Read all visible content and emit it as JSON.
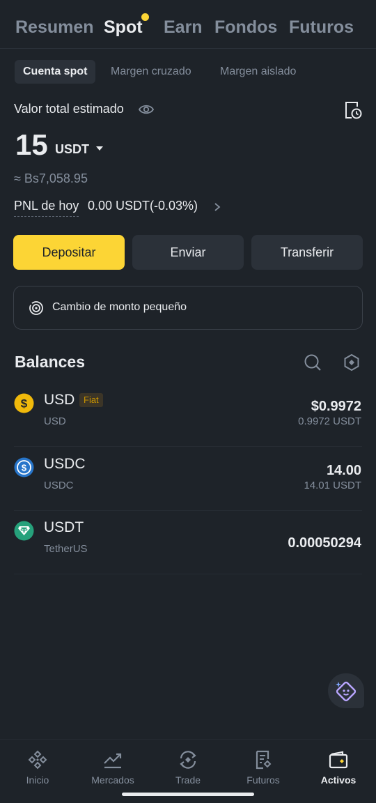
{
  "top_tabs": [
    {
      "label": "Resumen"
    },
    {
      "label": "Spot",
      "active": true
    },
    {
      "label": "Earn"
    },
    {
      "label": "Fondos"
    },
    {
      "label": "Futuros"
    }
  ],
  "sub_tabs": [
    {
      "label": "Cuenta spot",
      "active": true
    },
    {
      "label": "Margen cruzado"
    },
    {
      "label": "Margen aislado"
    }
  ],
  "summary": {
    "label": "Valor total estimado",
    "amount": "15",
    "currency": "USDT",
    "fiat_approx": "≈ Bs7,058.95",
    "pnl_label": "PNL de hoy",
    "pnl_value": "0.00 USDT(-0.03%)"
  },
  "actions": {
    "deposit": "Depositar",
    "send": "Enviar",
    "transfer": "Transferir"
  },
  "small_exchange": {
    "label": "Cambio de monto pequeño"
  },
  "balances": {
    "title": "Balances",
    "assets": [
      {
        "symbol": "USD",
        "name": "USD",
        "badge": "Fiat",
        "value": "$0.9972",
        "sub_value": "0.9972 USDT",
        "icon": "usd-coin-icon",
        "color": "#f0b90b"
      },
      {
        "symbol": "USDC",
        "name": "USDC",
        "value": "14.00",
        "sub_value": "14.01 USDT",
        "icon": "usdc-coin-icon",
        "color": "#2775ca"
      },
      {
        "symbol": "USDT",
        "name": "TetherUS",
        "value": "0.00050294",
        "icon": "usdt-coin-icon",
        "color": "#26a17b"
      }
    ]
  },
  "bottom_nav": [
    {
      "label": "Inicio",
      "icon": "home-icon"
    },
    {
      "label": "Mercados",
      "icon": "markets-icon"
    },
    {
      "label": "Trade",
      "icon": "trade-icon"
    },
    {
      "label": "Futuros",
      "icon": "futures-icon"
    },
    {
      "label": "Activos",
      "icon": "wallet-icon",
      "active": true
    }
  ],
  "colors": {
    "background": "#1e2329",
    "accent": "#fcd535",
    "text": "#eaecef",
    "muted": "#848e9c"
  }
}
